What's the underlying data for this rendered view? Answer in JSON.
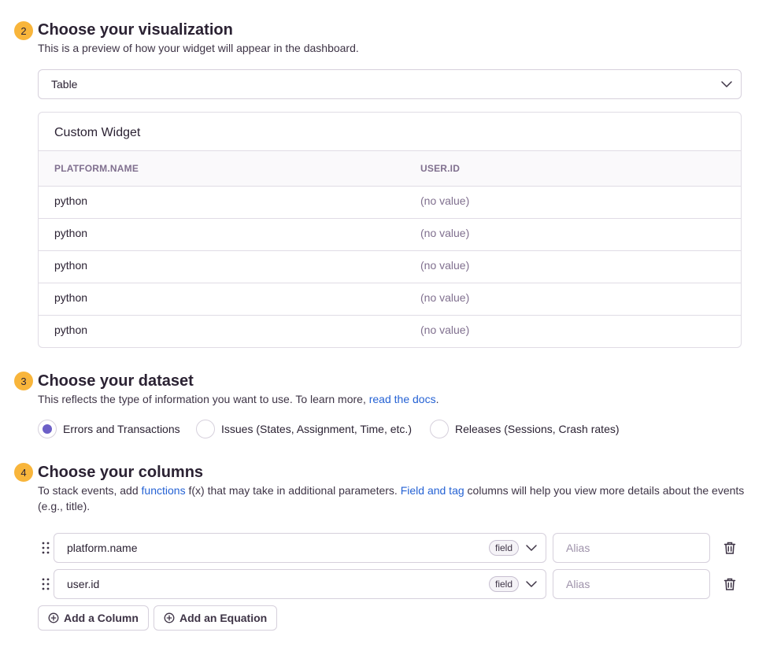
{
  "step2": {
    "number": "2",
    "title": "Choose your visualization",
    "description": "This is a preview of how your widget will appear in the dashboard.",
    "select_value": "Table"
  },
  "widget": {
    "title": "Custom Widget",
    "columns": [
      "PLATFORM.NAME",
      "USER.ID"
    ],
    "rows": [
      [
        "python",
        "(no value)"
      ],
      [
        "python",
        "(no value)"
      ],
      [
        "python",
        "(no value)"
      ],
      [
        "python",
        "(no value)"
      ],
      [
        "python",
        "(no value)"
      ]
    ]
  },
  "step3": {
    "number": "3",
    "title": "Choose your dataset",
    "description_prefix": "This reflects the type of information you want to use. To learn more, ",
    "description_link": "read the docs",
    "description_suffix": ".",
    "options": [
      {
        "label": "Errors and Transactions",
        "selected": true
      },
      {
        "label": "Issues (States, Assignment, Time, etc.)",
        "selected": false
      },
      {
        "label": "Releases (Sessions, Crash rates)",
        "selected": false
      }
    ]
  },
  "step4": {
    "number": "4",
    "title": "Choose your columns",
    "desc_part1": "To stack events, add ",
    "desc_link1": "functions",
    "desc_part2": " f(x) that may take in additional parameters. ",
    "desc_link2": "Field and tag",
    "desc_part3": " columns will help you view more details about the events (e.g., title).",
    "columns": [
      {
        "value": "platform.name",
        "tag": "field",
        "alias_placeholder": "Alias"
      },
      {
        "value": "user.id",
        "tag": "field",
        "alias_placeholder": "Alias"
      }
    ],
    "add_column_label": "Add a Column",
    "add_equation_label": "Add an Equation"
  },
  "colors": {
    "step_badge": "#f8b53b",
    "radio_selected": "#6c5fc7",
    "link": "#2562d4"
  }
}
